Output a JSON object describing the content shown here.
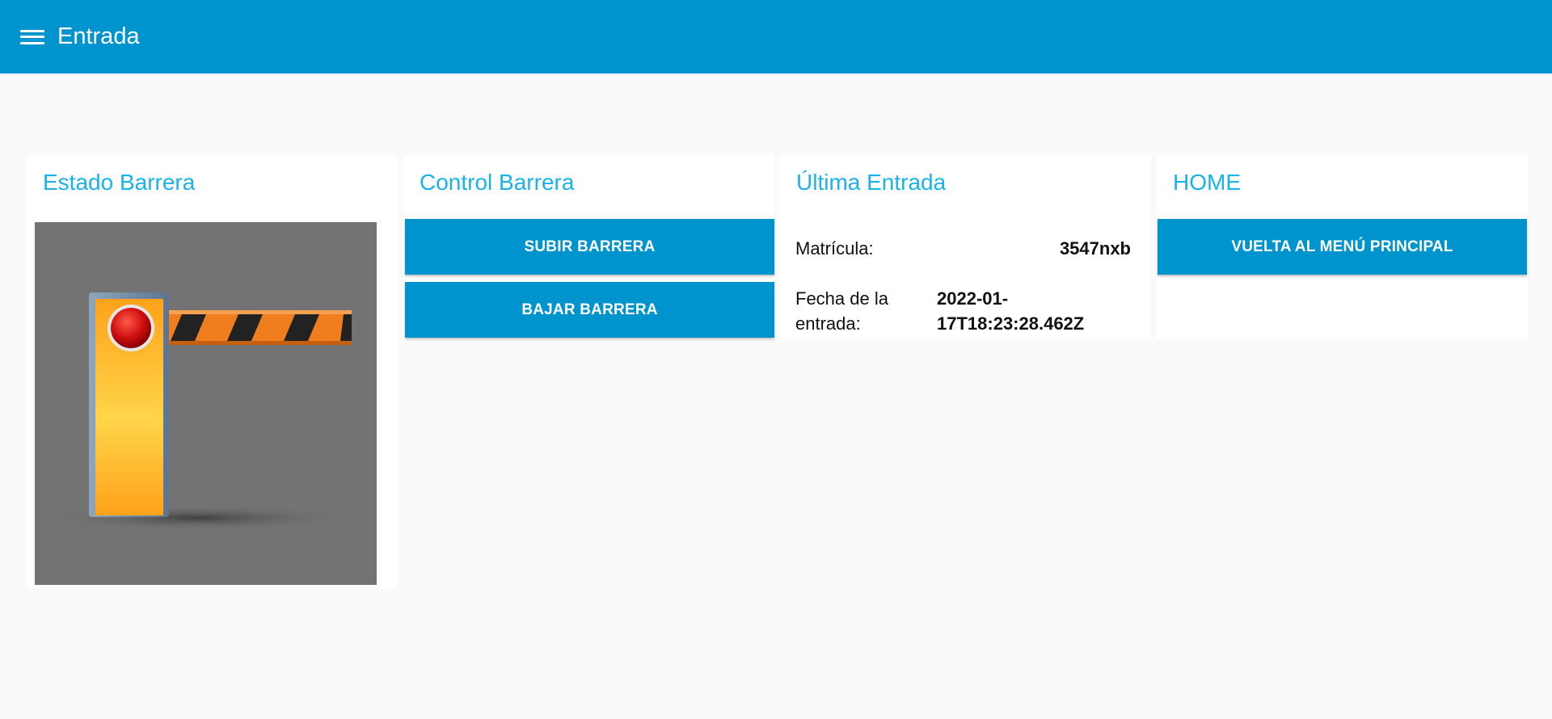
{
  "header": {
    "title": "Entrada",
    "menu_icon": "hamburger-menu-icon"
  },
  "estado": {
    "title": "Estado Barrera",
    "image_icon": "barrier-gate-illustration"
  },
  "control": {
    "title": "Control Barrera",
    "subir_label": "SUBIR BARRERA",
    "bajar_label": "BAJAR BARRERA"
  },
  "ultima": {
    "title": "Última Entrada",
    "matricula_label": "Matrícula:",
    "matricula_value": "3547nxb",
    "fecha_label_1": "Fecha de la",
    "fecha_label_2": "entrada:",
    "fecha_value_1": "2022-01-",
    "fecha_value_2": "17T18:23:28.462Z"
  },
  "home": {
    "title": "HOME",
    "button_label": "VUELTA AL MENÚ PRINCIPAL"
  },
  "colors": {
    "primary": "#0094ce",
    "title_accent": "#1ab2ea",
    "background": "#fafafa"
  }
}
